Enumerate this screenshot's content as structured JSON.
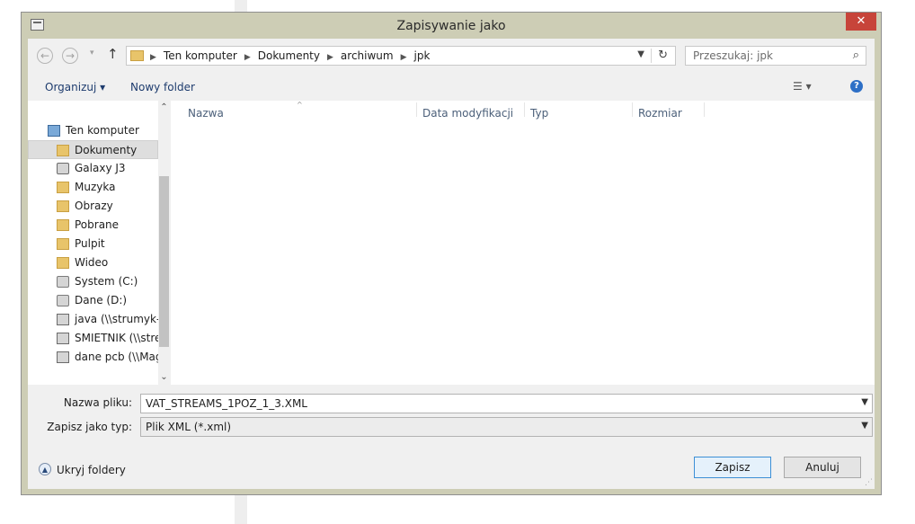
{
  "dialog": {
    "title": "Zapisywanie jako",
    "close_label": "✕"
  },
  "nav": {
    "back_glyph": "←",
    "forward_glyph": "→",
    "recent_glyph": "▾",
    "up_glyph": "↑",
    "breadcrumbs": [
      "Ten komputer",
      "Dokumenty",
      "archiwum",
      "jpk"
    ],
    "refresh_glyph": "↻",
    "search_placeholder": "Przeszukaj: jpk"
  },
  "toolbar": {
    "organize_label": "Organizuj ▾",
    "new_folder_label": "Nowy folder",
    "help_glyph": "?"
  },
  "navpane": {
    "items": [
      {
        "label": "Ten komputer",
        "icon": "computer-icon"
      },
      {
        "label": "Dokumenty",
        "icon": "folder-icon",
        "selected": true
      },
      {
        "label": "Galaxy J3",
        "icon": "camera-icon"
      },
      {
        "label": "Muzyka",
        "icon": "folder-icon"
      },
      {
        "label": "Obrazy",
        "icon": "folder-icon"
      },
      {
        "label": "Pobrane",
        "icon": "folder-icon"
      },
      {
        "label": "Pulpit",
        "icon": "folder-icon"
      },
      {
        "label": "Wideo",
        "icon": "folder-icon"
      },
      {
        "label": "System (C:)",
        "icon": "drive-icon"
      },
      {
        "label": "Dane (D:)",
        "icon": "drive-icon"
      },
      {
        "label": "java (\\\\strumyk-r",
        "icon": "network-drive-icon"
      },
      {
        "label": "SMIETNIK (\\\\stre",
        "icon": "network-drive-icon"
      },
      {
        "label": "dane pcb (\\\\Mag",
        "icon": "network-drive-icon"
      }
    ]
  },
  "filelist": {
    "columns": [
      "Nazwa",
      "Data modyfikacji",
      "Typ",
      "Rozmiar"
    ]
  },
  "form": {
    "filename_label": "Nazwa pliku:",
    "filename_value": "VAT_STREAMS_1POZ_1_3.XML",
    "type_label": "Zapisz jako typ:",
    "type_value": "Plik XML (*.xml)"
  },
  "footer": {
    "hide_folders_label": "Ukryj foldery",
    "save_label": "Zapisz",
    "cancel_label": "Anuluj"
  },
  "colors": {
    "frame": "#cdcdb5",
    "close": "#c7443a",
    "client": "#f0f0f0",
    "link_text": "#1e3c6e",
    "primary_border": "#3c8fd6"
  }
}
